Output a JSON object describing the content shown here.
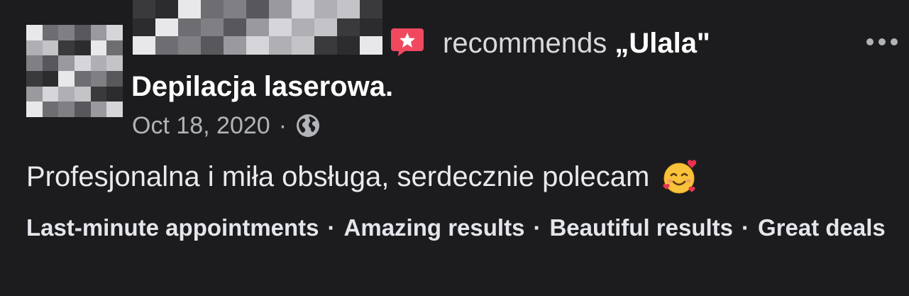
{
  "post": {
    "verb": "recommends",
    "page_name": "„Ulala\"",
    "service": "Depilacja laserowa.",
    "date": "Oct 18, 2020",
    "separator": "·",
    "body": "Profesjonalna i miła obsługa, serdecznie polecam",
    "tags": [
      "Last-minute appointments",
      "Amazing results",
      "Beautiful results",
      "Great deals"
    ]
  },
  "icons": {
    "recommend": "recommend-star-icon",
    "privacy": "globe-icon",
    "emoji": "smiling-face-with-hearts-emoji",
    "more": "more-options-icon"
  },
  "colors": {
    "background": "#1c1c1e",
    "recommend_badge": "#f0495f",
    "secondary_text": "#b0b3b8"
  }
}
